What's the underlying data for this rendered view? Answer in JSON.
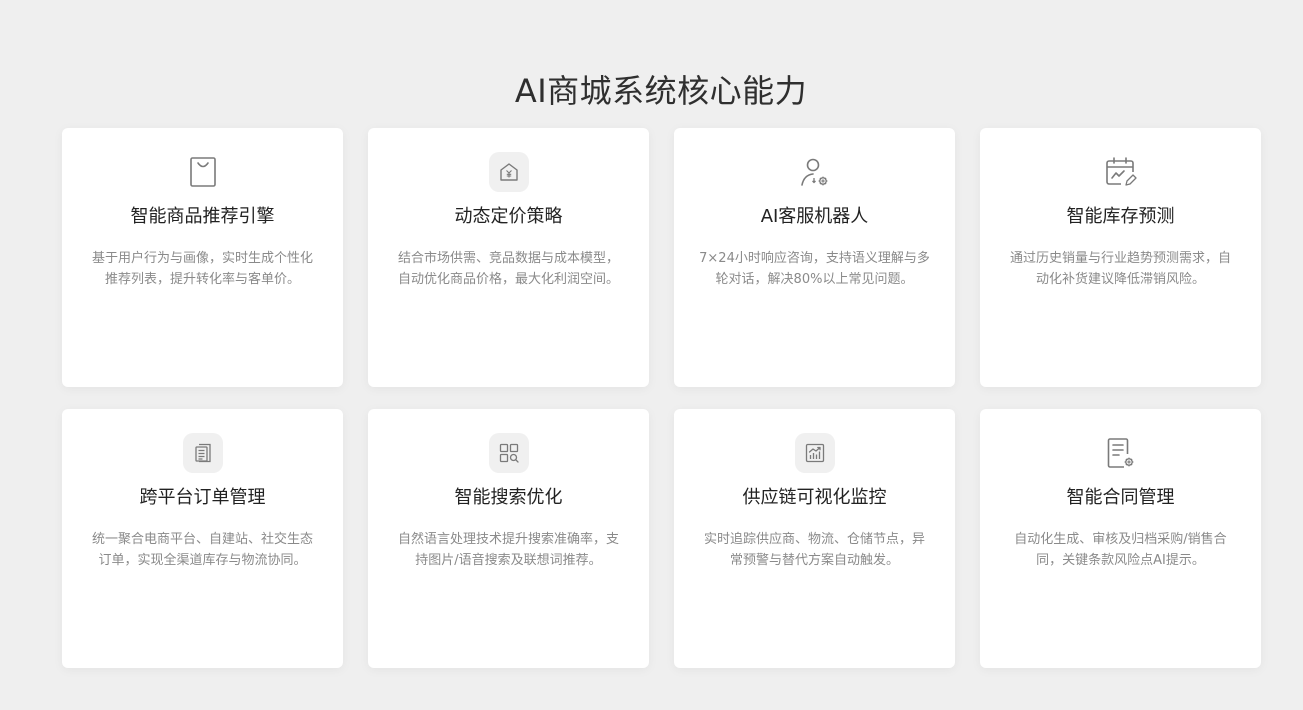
{
  "page": {
    "title": "AI商城系统核心能力"
  },
  "cards": [
    {
      "icon": "shopping-bag-icon",
      "title": "智能商品推荐引擎",
      "desc": "基于用户行为与画像，实时生成个性化推荐列表，提升转化率与客单价。"
    },
    {
      "icon": "yuan-house-icon",
      "title": "动态定价策略",
      "desc": "结合市场供需、竞品数据与成本模型，自动优化商品价格，最大化利润空间。"
    },
    {
      "icon": "user-gear-icon",
      "title": "AI客服机器人",
      "desc": "7×24小时响应咨询，支持语义理解与多轮对话，解决80%以上常见问题。"
    },
    {
      "icon": "calendar-chart-icon",
      "title": "智能库存预测",
      "desc": "通过历史销量与行业趋势预测需求，自动化补货建议降低滞销风险。"
    },
    {
      "icon": "document-list-icon",
      "title": "跨平台订单管理",
      "desc": "统一聚合电商平台、自建站、社交生态订单，实现全渠道库存与物流协同。"
    },
    {
      "icon": "grid-search-icon",
      "title": "智能搜索优化",
      "desc": "自然语言处理技术提升搜索准确率，支持图片/语音搜索及联想词推荐。"
    },
    {
      "icon": "chart-box-icon",
      "title": "供应链可视化监控",
      "desc": "实时追踪供应商、物流、仓储节点，异常预警与替代方案自动触发。"
    },
    {
      "icon": "document-gear-icon",
      "title": "智能合同管理",
      "desc": "自动化生成、审核及归档采购/销售合同，关键条款风险点AI提示。"
    }
  ]
}
